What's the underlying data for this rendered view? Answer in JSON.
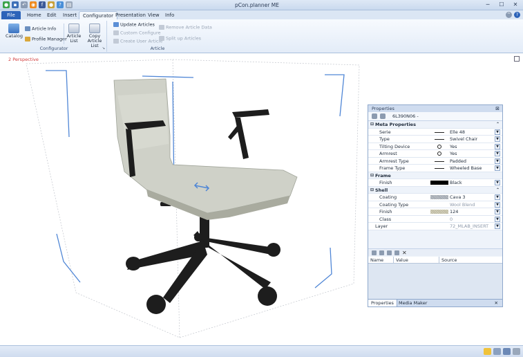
{
  "window": {
    "title": "pCon.planner ME",
    "minimize": "─",
    "maximize": "☐",
    "close": "✕"
  },
  "tabs": [
    "File",
    "Home",
    "Edit",
    "Insert",
    "Configurator",
    "Presentation",
    "View",
    "Info"
  ],
  "ribbon": {
    "configurator_group": {
      "label": "Configurator",
      "catalog": "Catalog",
      "article_info": "Article Info",
      "profile_manager": "Profile Manager"
    },
    "article_group": {
      "label": "Article",
      "article_list": "Article List",
      "copy_article_list": "Copy Article List",
      "update_articles": "Update Articles",
      "custom_configure": "Custom Configure",
      "create_user_article": "Create User Article",
      "remove_article_data": "Remove Article Data",
      "split_up_articles": "Split up Articles"
    }
  },
  "viewport": {
    "label": "2 Perspective"
  },
  "properties": {
    "title": "Properties",
    "article_code": "6L390N06 -",
    "sections": {
      "meta": "Meta Properties",
      "frame": "Frame",
      "shell": "Shell"
    },
    "rows": {
      "serie": {
        "k": "Serie",
        "v": "Elle 48"
      },
      "type": {
        "k": "Type",
        "v": "Swivel Chair"
      },
      "tilting": {
        "k": "Tilting Device",
        "v": "Yes"
      },
      "armrest": {
        "k": "Armrest",
        "v": "Yes"
      },
      "armrest_type": {
        "k": "Armrest Type",
        "v": "Padded"
      },
      "frame_type": {
        "k": "Frame Type",
        "v": "Wheeled Base"
      },
      "frame_finish": {
        "k": "Finish",
        "v": "Black"
      },
      "coating": {
        "k": "Coating",
        "v": "Cava 3"
      },
      "coating_type": {
        "k": "Coating Type",
        "v": "Wool Blend"
      },
      "shell_finish": {
        "k": "Finish",
        "v": "124"
      },
      "class": {
        "k": "Class",
        "v": "0"
      },
      "layer": {
        "k": "Layer",
        "v": "72_MLAB_INSERT"
      }
    },
    "grid_headers": [
      "Name",
      "Value",
      "Source"
    ],
    "bottom_tabs": [
      "Properties",
      "Media Maker"
    ]
  },
  "colors": {
    "accent": "#2c63b9",
    "frame_swatch": "#000000",
    "viewport_label": "#d23c3c",
    "guide": "#4f86d6"
  }
}
